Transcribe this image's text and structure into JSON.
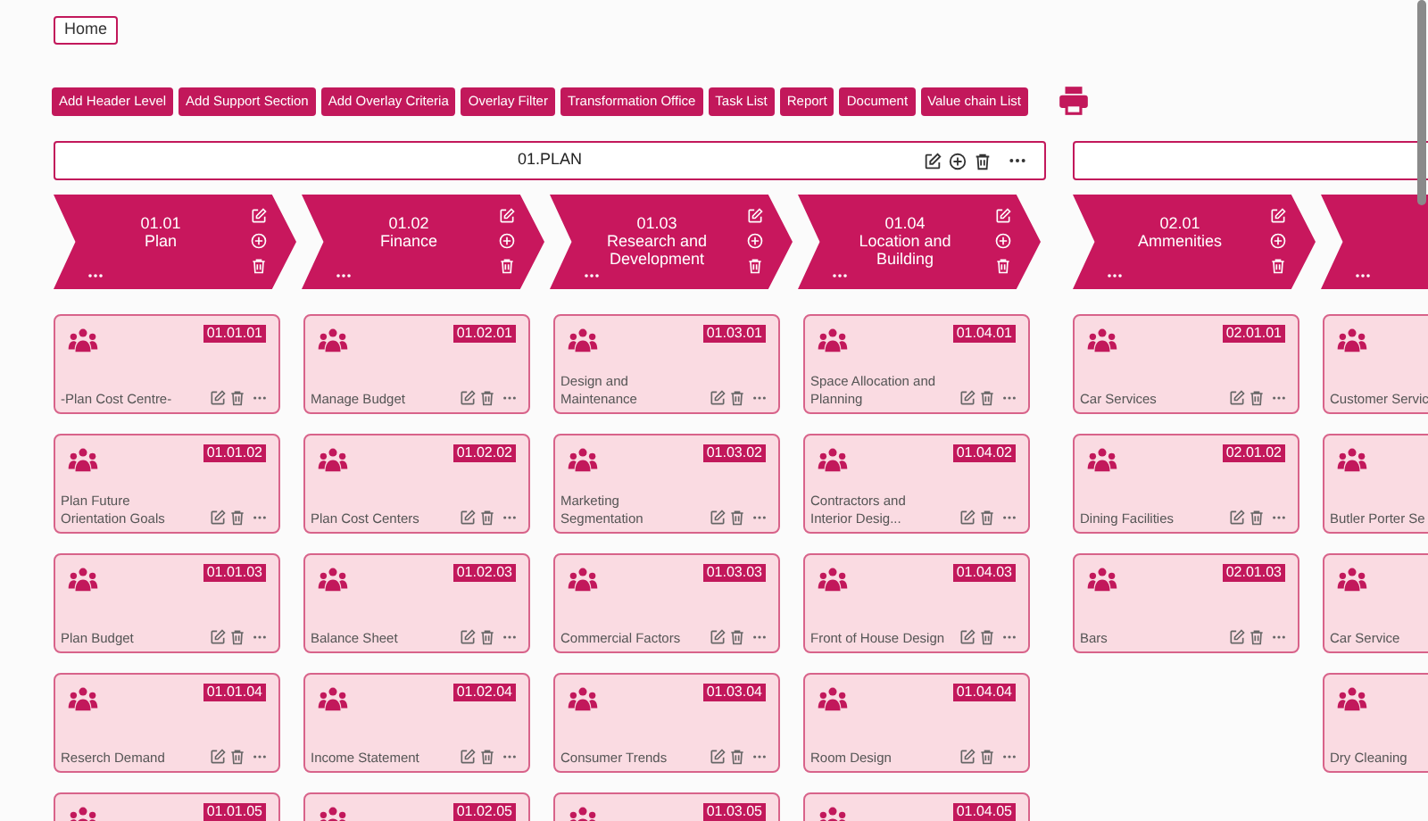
{
  "home_button": "Home",
  "toolbar": [
    "Add Header Level",
    "Add Support Section",
    "Add Overlay Criteria",
    "Overlay Filter",
    "Transformation Office",
    "Task List",
    "Report",
    "Document",
    "Value chain List"
  ],
  "groups": [
    {
      "title": "01.PLAN",
      "stages": [
        {
          "code": "01.01",
          "name": "Plan",
          "cards": [
            {
              "code": "01.01.01",
              "name": "-Plan Cost Centre-"
            },
            {
              "code": "01.01.02",
              "name": "Plan Future Orientation Goals"
            },
            {
              "code": "01.01.03",
              "name": "Plan Budget"
            },
            {
              "code": "01.01.04",
              "name": "Reserch Demand"
            },
            {
              "code": "01.01.05"
            }
          ]
        },
        {
          "code": "01.02",
          "name": "Finance",
          "cards": [
            {
              "code": "01.02.01",
              "name": "Manage Budget"
            },
            {
              "code": "01.02.02",
              "name": "Plan Cost Centers"
            },
            {
              "code": "01.02.03",
              "name": "Balance Sheet"
            },
            {
              "code": "01.02.04",
              "name": "Income Statement"
            },
            {
              "code": "01.02.05"
            }
          ]
        },
        {
          "code": "01.03",
          "name": "Research and Development",
          "cards": [
            {
              "code": "01.03.01",
              "name": "Design and Maintenance"
            },
            {
              "code": "01.03.02",
              "name": "Marketing Segmentation"
            },
            {
              "code": "01.03.03",
              "name": "Commercial Factors"
            },
            {
              "code": "01.03.04",
              "name": "Consumer Trends"
            },
            {
              "code": "01.03.05"
            }
          ]
        },
        {
          "code": "01.04",
          "name": "Location and Building",
          "cards": [
            {
              "code": "01.04.01",
              "name": "Space Allocation and Planning"
            },
            {
              "code": "01.04.02",
              "name": "Contractors and Interior Desig..."
            },
            {
              "code": "01.04.03",
              "name": "Front of House Design"
            },
            {
              "code": "01.04.04",
              "name": "Room Design"
            },
            {
              "code": "01.04.05"
            }
          ]
        }
      ]
    },
    {
      "stages": [
        {
          "code": "02.01",
          "name": "Ammenities",
          "cards": [
            {
              "code": "02.01.01",
              "name": "Car Services"
            },
            {
              "code": "02.01.02",
              "name": "Dining Facilities"
            },
            {
              "code": "02.01.03",
              "name": "Bars"
            }
          ]
        },
        {
          "cards": [
            {
              "name": "Customer Servic"
            },
            {
              "name": "Butler Porter Se"
            },
            {
              "name": "Car Service"
            },
            {
              "name": "Dry Cleaning"
            }
          ]
        }
      ]
    }
  ]
}
